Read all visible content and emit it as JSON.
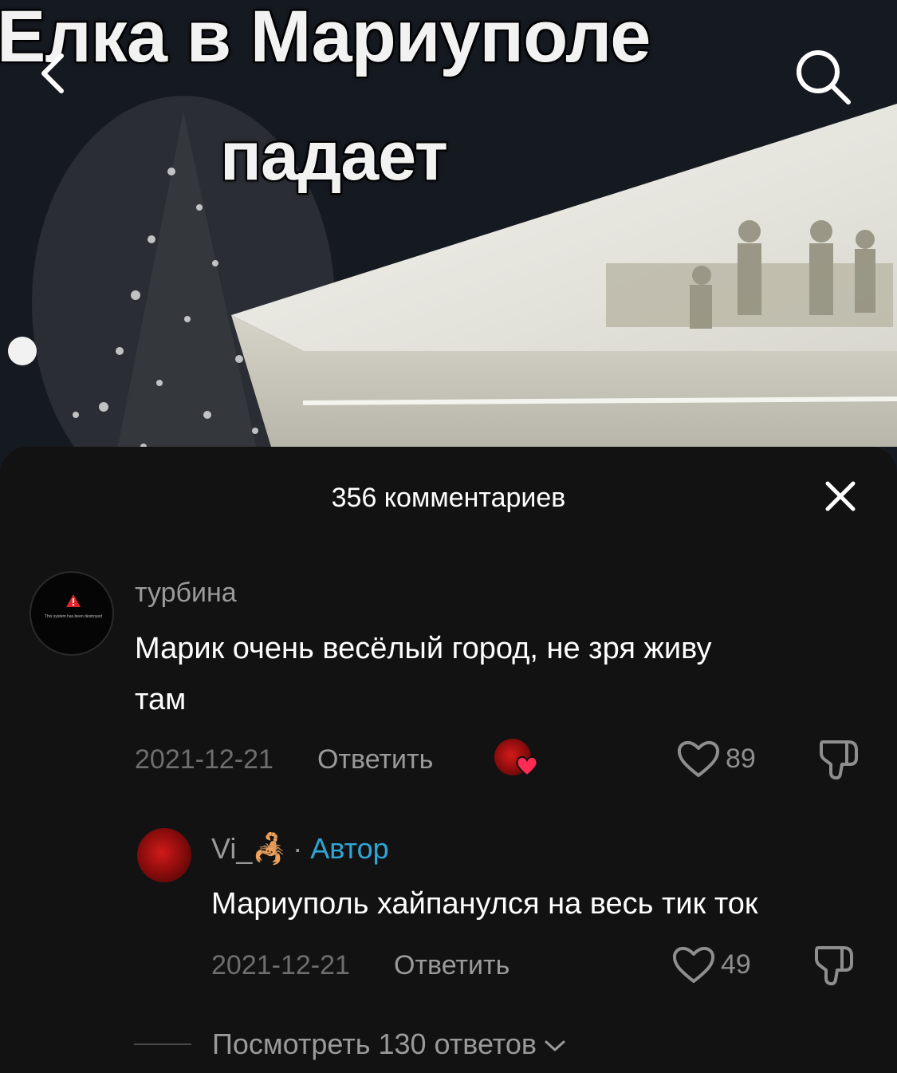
{
  "video": {
    "caption_line1": "Елка в Мариуполе",
    "caption_line2": "падает"
  },
  "icons": {
    "back": "chevron-left-icon",
    "search": "search-icon",
    "close": "close-icon",
    "like": "heart-outline-icon",
    "dislike": "thumbs-down-icon",
    "expand": "chevron-down-icon"
  },
  "colors": {
    "sheet_bg": "#121212",
    "author_badge": "#2ea6d8",
    "liked_heart": "#fe2c55"
  },
  "comments_sheet": {
    "title": "356 комментариев",
    "comments": [
      {
        "username": "турбина",
        "avatar_text": "This system has been destroyed",
        "text_line1": "Марик очень весёлый город, не зря живу",
        "text_line2": "там",
        "date": "2021-12-21",
        "reply_label": "Ответить",
        "likes": "89"
      }
    ],
    "replies": [
      {
        "username": "Vi_🦂",
        "separator": "·",
        "badge": "Автор",
        "text": "Мариуполь хайпанулся на весь тик ток",
        "date": "2021-12-21",
        "reply_label": "Ответить",
        "likes": "49"
      }
    ],
    "view_replies_label": "Посмотреть 130 ответов"
  }
}
